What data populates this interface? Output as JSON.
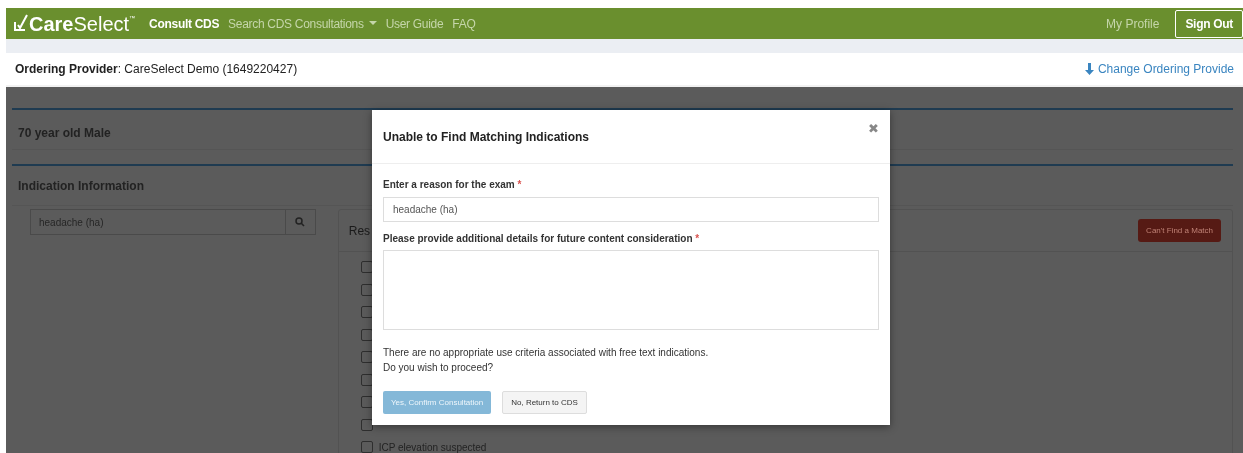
{
  "nav": {
    "brand_bold": "Care",
    "brand_light": "Select",
    "brand_mark": "™",
    "items": [
      {
        "label": "Consult CDS",
        "selected": true,
        "dropdown": false
      },
      {
        "label": "Search CDS Consultations",
        "selected": false,
        "dropdown": true
      },
      {
        "label": "User Guide",
        "selected": false,
        "dropdown": false
      },
      {
        "label": "FAQ",
        "selected": false,
        "dropdown": false
      }
    ],
    "profile": "My Profile",
    "sign_out": "Sign Out"
  },
  "provider": {
    "label": "Ordering Provider",
    "value": ": CareSelect Demo (1649220427)",
    "change": "Change Ordering Provide"
  },
  "patient": {
    "summary": "70 year old Male"
  },
  "indication": {
    "title": "Indication Information",
    "search_value": "headache (ha)",
    "results_title": "Res",
    "cant_find": "Can't Find a Match",
    "results": [
      {
        "checked": false
      },
      {
        "checked": false
      },
      {
        "checked": false
      },
      {
        "checked": false
      },
      {
        "checked": false
      },
      {
        "checked": false
      },
      {
        "checked": false
      },
      {
        "checked": false
      },
      {
        "checked": false,
        "label": "ICP elevation suspected"
      }
    ]
  },
  "modal": {
    "title": "Unable to Find Matching Indications",
    "close": "✖",
    "reason_label": "Enter a reason for the exam",
    "reason_value": "headache (ha)",
    "details_label": "Please provide additional details for future content consideration",
    "required_mark": "*",
    "message": [
      "There are no appropriate use criteria associated with free text indications.",
      "Do you wish to proceed?"
    ],
    "confirm": {
      "label": "Yes, Confirm Consultation",
      "disabled": true
    },
    "cancel": {
      "label": "No, Return to CDS"
    }
  }
}
